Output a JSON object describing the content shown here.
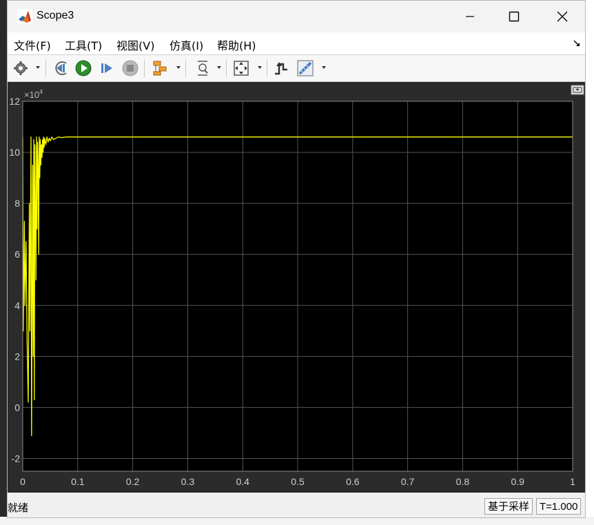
{
  "window": {
    "title": "Scope3"
  },
  "menu": [
    {
      "label": "文件(F)"
    },
    {
      "label": "工具(T)"
    },
    {
      "label": "视图(V)"
    },
    {
      "label": "仿真(I)"
    },
    {
      "label": "帮助(H)"
    }
  ],
  "toolbar": {
    "icons": [
      "gear-icon",
      "step-back-icon",
      "run-icon",
      "step-forward-icon",
      "stop-icon",
      "highlight-icon",
      "zoom-icon",
      "fit-icon",
      "triggers-icon",
      "measure-icon"
    ]
  },
  "status": {
    "ready": "就绪",
    "mode": "基于采样",
    "time": "T=1.000"
  },
  "colors": {
    "trace": "#ffff00",
    "plot_bg": "#000000",
    "grid": "#555555",
    "tick_label": "#d0d0d0"
  },
  "chart_data": {
    "type": "line",
    "multiplier": "×10",
    "multiplier_exp": "4",
    "xlim": [
      0,
      1
    ],
    "ylim": [
      -2.5,
      12
    ],
    "x_ticks": [
      {
        "v": 0,
        "label": "0"
      },
      {
        "v": 0.1,
        "label": "0.1"
      },
      {
        "v": 0.2,
        "label": "0.2"
      },
      {
        "v": 0.3,
        "label": "0.3"
      },
      {
        "v": 0.4,
        "label": "0.4"
      },
      {
        "v": 0.5,
        "label": "0.5"
      },
      {
        "v": 0.6,
        "label": "0.6"
      },
      {
        "v": 0.7,
        "label": "0.7"
      },
      {
        "v": 0.8,
        "label": "0.8"
      },
      {
        "v": 0.9,
        "label": "0.9"
      },
      {
        "v": 1,
        "label": "1"
      }
    ],
    "y_ticks": [
      {
        "v": -2,
        "label": "-2"
      },
      {
        "v": 0,
        "label": "0"
      },
      {
        "v": 2,
        "label": "2"
      },
      {
        "v": 4,
        "label": "4"
      },
      {
        "v": 6,
        "label": "6"
      },
      {
        "v": 8,
        "label": "8"
      },
      {
        "v": 10,
        "label": "10"
      },
      {
        "v": 12,
        "label": "12"
      }
    ],
    "grid": true,
    "series": [
      {
        "x": [
          0,
          0.001,
          0.003,
          0.004,
          0.006,
          0.008,
          0.01,
          0.012,
          0.013,
          0.015,
          0.016,
          0.018,
          0.019,
          0.02,
          0.021,
          0.022,
          0.024,
          0.025,
          0.026,
          0.027,
          0.028,
          0.029,
          0.03,
          0.031,
          0.032,
          0.033,
          0.034,
          0.035,
          0.036,
          0.037,
          0.038,
          0.039,
          0.04,
          0.042,
          0.044,
          0.046,
          0.048,
          0.05,
          0.053,
          0.056,
          0.06,
          0.065,
          0.07,
          0.08,
          0.1,
          0.15,
          0.2,
          0.3,
          0.4,
          0.5,
          0.6,
          0.7,
          0.8,
          0.9,
          1.0
        ],
        "y": [
          10.6,
          3.0,
          7.3,
          4.0,
          6.5,
          2.5,
          0.2,
          8.0,
          3.0,
          10.6,
          -1.1,
          9.5,
          2.0,
          10.5,
          0.3,
          10.3,
          5.0,
          10.6,
          7.0,
          10.4,
          9.5,
          6.0,
          10.6,
          9.0,
          10.5,
          9.5,
          10.3,
          9.8,
          10.5,
          10.0,
          10.6,
          10.2,
          10.55,
          10.3,
          10.6,
          10.4,
          10.55,
          10.45,
          10.6,
          10.5,
          10.55,
          10.6,
          10.58,
          10.6,
          10.6,
          10.6,
          10.6,
          10.6,
          10.6,
          10.6,
          10.6,
          10.6,
          10.6,
          10.6,
          10.6
        ]
      }
    ]
  }
}
